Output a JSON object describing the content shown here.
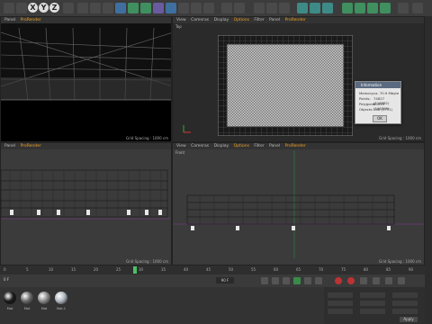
{
  "toolbar": {
    "axis_labels": [
      "X",
      "Y",
      "Z"
    ]
  },
  "viewport_tl": {
    "menu": [
      "Panel",
      "ProRender"
    ],
    "grid_spacing": "Grid Spacing : 1000 cm"
  },
  "viewport_tr": {
    "menu": [
      "View",
      "Cameras",
      "Display",
      "Options",
      "Filter",
      "Panel",
      "ProRender"
    ],
    "label": "Top",
    "grid_spacing": "Grid Spacing : 1000 cm"
  },
  "viewport_bl": {
    "menu": [
      "Panel",
      "ProRender"
    ],
    "grid_spacing": "Grid Spacing : 1000 cm"
  },
  "viewport_br": {
    "menu": [
      "View",
      "Cameras",
      "Display",
      "Options",
      "Filter",
      "Panel",
      "ProRender"
    ],
    "label": "Front",
    "grid_spacing": "Grid Spacing : 1000 cm"
  },
  "info_dialog": {
    "title": "Information",
    "rows": [
      {
        "label": "Memory:",
        "value": "ca. 70.9 Mbyte"
      },
      {
        "label": "Points:",
        "value": "74827 (116982)"
      },
      {
        "label": "Polygons:",
        "value": "60410 (106398)"
      },
      {
        "label": "Objects:",
        "value": "148 (1771)"
      }
    ],
    "ok": "OK"
  },
  "timeline": {
    "ticks": [
      "0",
      "5",
      "10",
      "15",
      "20",
      "25",
      "30",
      "35",
      "40",
      "45",
      "50",
      "55",
      "60",
      "65",
      "70",
      "75",
      "80",
      "85",
      "90"
    ],
    "current_frame": "0 F",
    "end_frame": "90 F"
  },
  "materials": [
    {
      "name": "Mat",
      "color": "#1a1a1a"
    },
    {
      "name": "Mat",
      "color": "#6a6a6a"
    },
    {
      "name": "Mat",
      "color": "#8a8a8a"
    },
    {
      "name": "Mat.1",
      "color": "#b0b8c0"
    }
  ],
  "attributes": {
    "apply": "Apply"
  }
}
